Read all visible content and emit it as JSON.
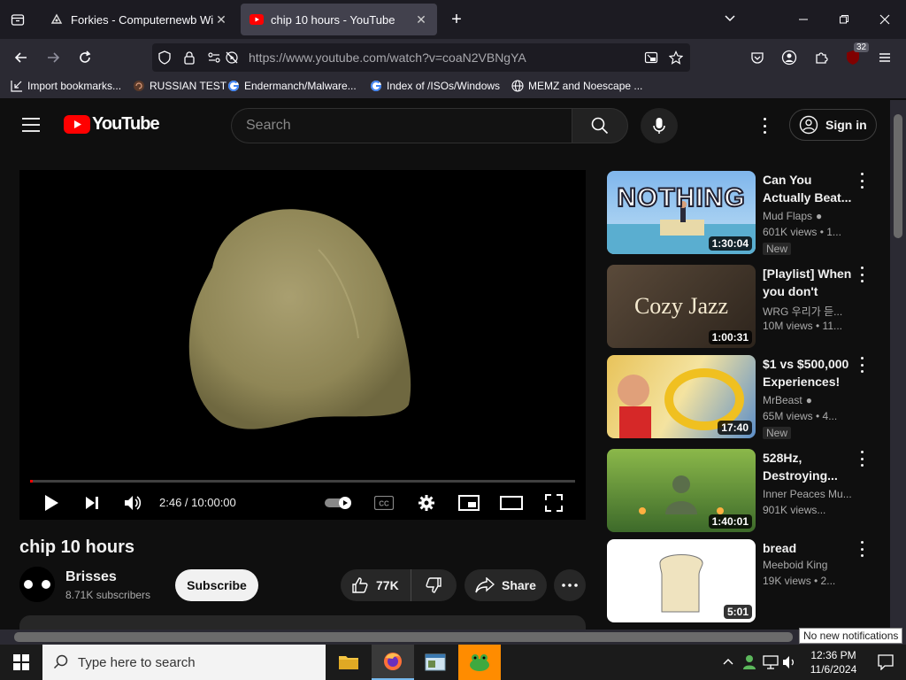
{
  "browser": {
    "tabs": [
      {
        "title": "Forkies - Computernewb Wiki",
        "active": false
      },
      {
        "title": "chip 10 hours - YouTube",
        "active": true
      }
    ],
    "url": "https://www.youtube.com/watch?v=coaN2VBNgYA",
    "extension_badge": "32",
    "bookmarks": [
      {
        "label": "Import bookmarks...",
        "icon": "import-icon"
      },
      {
        "label": "RUSSIAN TEST",
        "icon": "spiral-icon"
      },
      {
        "label": "Endermanch/Malware...",
        "icon": "google-icon"
      },
      {
        "label": "Index of /ISOs/Windows",
        "icon": "google-icon"
      },
      {
        "label": "MEMZ and Noescape ...",
        "icon": "globe-icon"
      }
    ]
  },
  "youtube": {
    "logo_text": "YouTube",
    "search_placeholder": "Search",
    "sign_in": "Sign in",
    "video": {
      "title": "chip 10 hours",
      "time_current": "2:46",
      "time_total": "10:00:00",
      "progress_fraction": 0.0046
    },
    "channel": {
      "name": "Brisses",
      "subscribers": "8.71K subscribers",
      "subscribe_label": "Subscribe"
    },
    "actions": {
      "likes": "77K",
      "share": "Share"
    },
    "recommendations": [
      {
        "title": "Can You Actually Beat...",
        "channel": "Mud Flaps",
        "verified": true,
        "meta": "601K views • 1...",
        "new": "New",
        "duration": "1:30:04",
        "thumb_text": "NOTHING"
      },
      {
        "title": "[Playlist] When you don't want...",
        "channel": "WRG 우리가 듣...",
        "verified": false,
        "meta": "10M views • 11...",
        "new": "",
        "duration": "1:00:31",
        "thumb_text": "Cozy Jazz"
      },
      {
        "title": "$1 vs $500,000 Experiences!",
        "channel": "MrBeast",
        "verified": true,
        "meta": "65M views • 4...",
        "new": "New",
        "duration": "17:40",
        "thumb_text": ""
      },
      {
        "title": "528Hz, Destroying...",
        "channel": "Inner Peaces Mu...",
        "verified": false,
        "meta": "901K views...",
        "new": "",
        "duration": "1:40:01",
        "thumb_text": ""
      },
      {
        "title": "bread",
        "channel": "Meeboid King",
        "verified": false,
        "meta": "19K views • 2...",
        "new": "",
        "duration": "5:01",
        "thumb_text": ""
      }
    ]
  },
  "taskbar": {
    "search_placeholder": "Type here to search",
    "time": "12:36 PM",
    "date": "11/6/2024",
    "notification_tooltip": "No new notifications"
  },
  "colors": {
    "youtube_red": "#ff0000",
    "page_bg": "#0f0f0f",
    "tab_active": "#42414d"
  }
}
